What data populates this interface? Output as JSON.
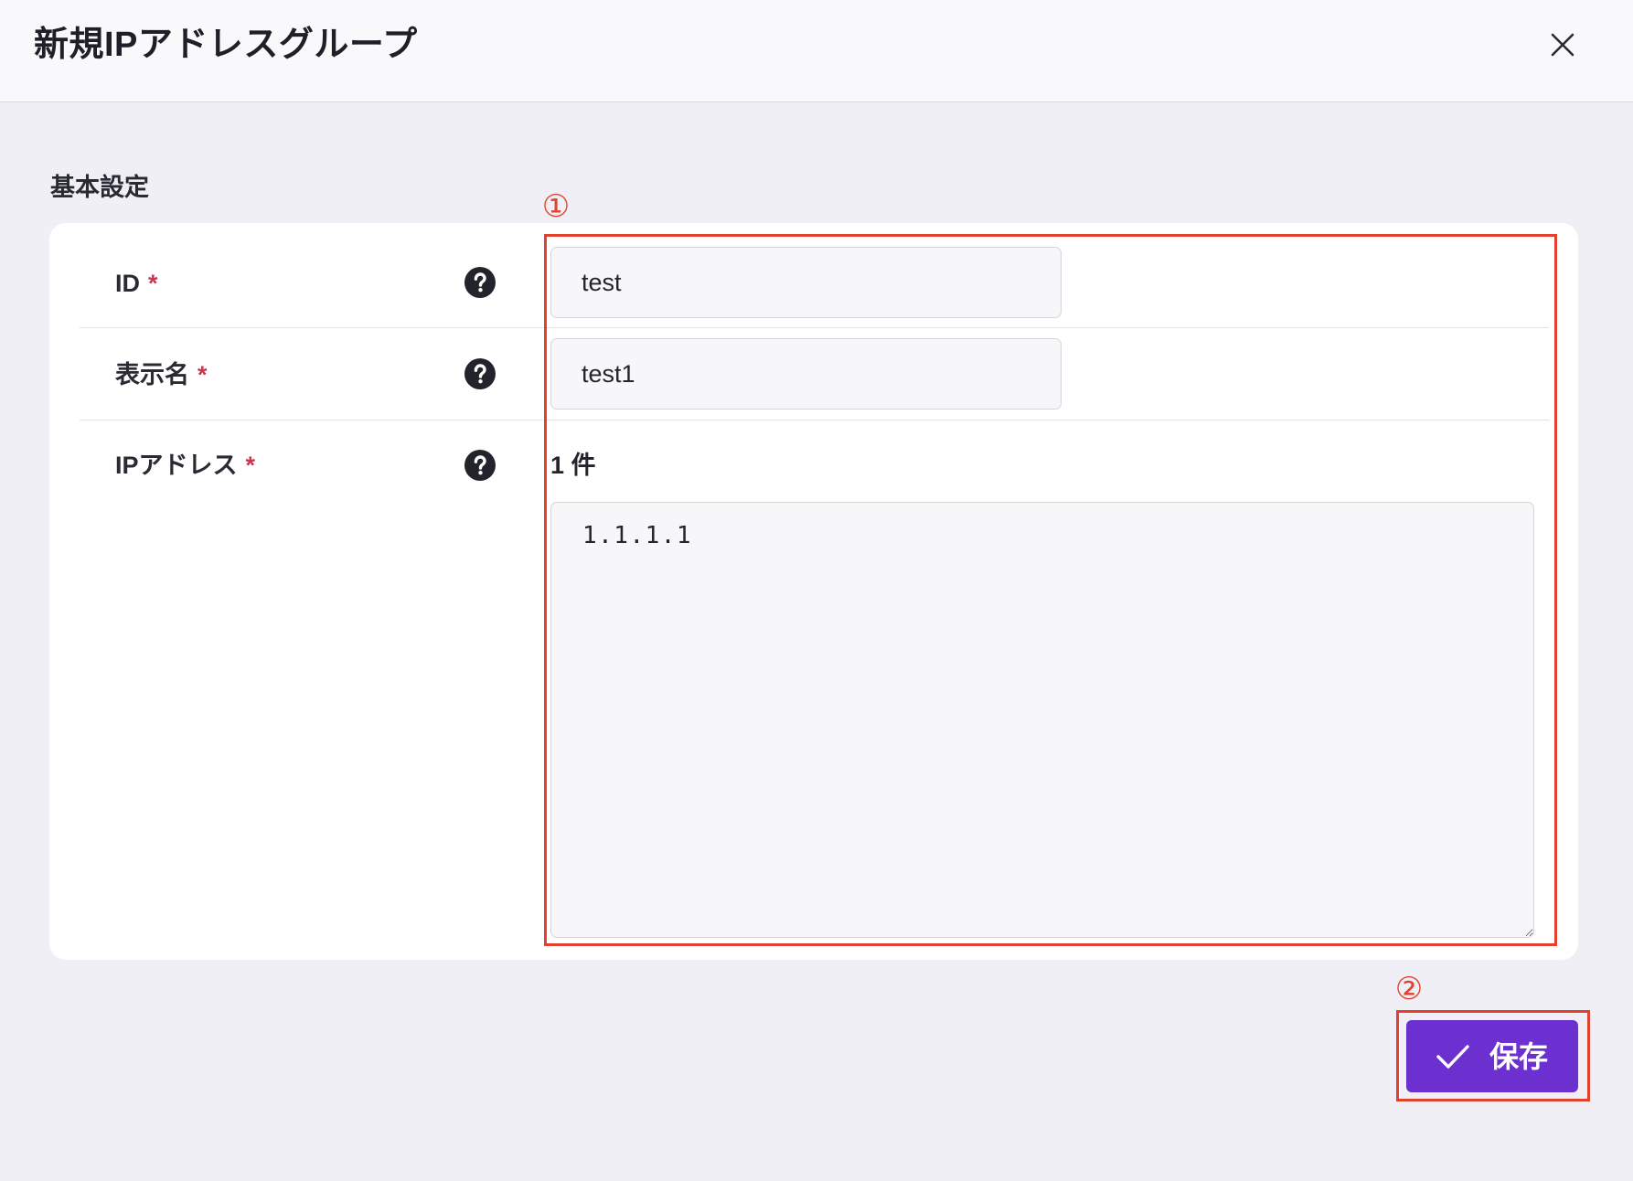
{
  "dialog": {
    "title": "新規IPアドレスグループ",
    "close_icon": "close-icon"
  },
  "basic_settings": {
    "title": "基本設定",
    "fields": {
      "id": {
        "label": "ID",
        "required_mark": "*",
        "help_icon": "question-circle-icon",
        "value": "test"
      },
      "display_name": {
        "label": "表示名",
        "required_mark": "*",
        "help_icon": "question-circle-icon",
        "value": "test1"
      },
      "ip_address": {
        "label": "IPアドレス",
        "required_mark": "*",
        "help_icon": "question-circle-icon",
        "count": "1 件",
        "value": "1.1.1.1"
      }
    }
  },
  "footer": {
    "save_label": "保存",
    "save_icon": "check-icon"
  },
  "annotations": {
    "marker_1": "①",
    "marker_2": "②"
  },
  "colors": {
    "accent": "#6b30cf",
    "annotation": "#e2412f",
    "required": "#c8364f",
    "background": "#efeff5",
    "header_background": "#f9f9fb"
  }
}
